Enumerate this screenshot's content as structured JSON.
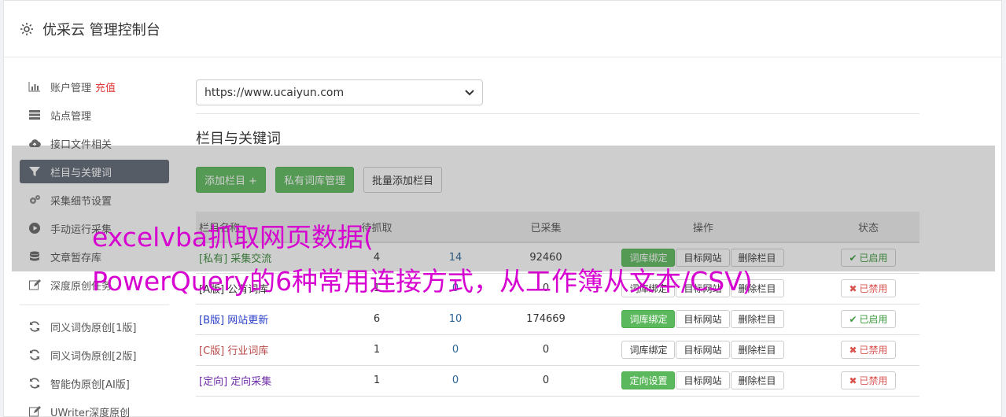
{
  "header": {
    "title": "优采云 管理控制台"
  },
  "sidebar": {
    "group1": [
      {
        "label": "账户管理",
        "extra": "充值",
        "icon": "bar-chart-icon"
      },
      {
        "label": "站点管理",
        "icon": "server-icon"
      },
      {
        "label": "接口文件相关",
        "icon": "cloud-upload-icon"
      },
      {
        "label": "栏目与关键词",
        "icon": "filter-icon",
        "active": true
      },
      {
        "label": "采集细节设置",
        "icon": "cogs-icon"
      },
      {
        "label": "手动运行采集",
        "icon": "play-circle-icon"
      },
      {
        "label": "文章暂存库",
        "icon": "database-icon"
      },
      {
        "label": "深度原创任务",
        "icon": "edit-icon"
      }
    ],
    "group2": [
      {
        "label": "同义词伪原创[1版]",
        "icon": "refresh-icon"
      },
      {
        "label": "同义词伪原创[2版]",
        "icon": "refresh-icon"
      },
      {
        "label": "智能伪原创[AI版]",
        "icon": "refresh-icon"
      },
      {
        "label": "UWriter深度原创",
        "icon": "edit-icon"
      }
    ]
  },
  "main": {
    "site_select": "https://www.ucaiyun.com",
    "section_title": "栏目与关键词",
    "buttons": {
      "add": "添加栏目 +",
      "private": "私有词库管理",
      "batch": "批量添加栏目"
    },
    "table": {
      "headers": [
        "栏目名称",
        "待抓取",
        "已采集",
        "操作",
        "状态"
      ],
      "rows": [
        {
          "tag": "[私有]",
          "name": "采集交流",
          "pending": "4",
          "pending2": "14",
          "collected": "92460",
          "op1": "词库绑定",
          "op1_green": true,
          "status": "已启用",
          "on": true
        },
        {
          "tag": "[A版]",
          "name": "公有词库",
          "pending": "1",
          "pending2": "0",
          "collected": "0",
          "op1": "词库绑定",
          "op1_green": false,
          "status": "已禁用",
          "on": false
        },
        {
          "tag": "[B版]",
          "name": "网站更新",
          "pending": "6",
          "pending2": "10",
          "collected": "174669",
          "op1": "词库绑定",
          "op1_green": true,
          "status": "已启用",
          "on": true
        },
        {
          "tag": "[C版]",
          "name": "行业词库",
          "pending": "1",
          "pending2": "0",
          "collected": "0",
          "op1": "词库绑定",
          "op1_green": false,
          "status": "已禁用",
          "on": false
        },
        {
          "tag": "[定向]",
          "name": "定向采集",
          "pending": "1",
          "pending2": "0",
          "collected": "0",
          "op1": "定向设置",
          "op1_green": true,
          "status": "已禁用",
          "on": false
        }
      ],
      "op2": "目标网站",
      "op3": "删除栏目"
    }
  },
  "overlay": {
    "line1": "excelvba抓取网页数据(",
    "line2": "PowerQuery的6种常用连接方式，从工作簿从文本/CSV)"
  },
  "colors": {
    "green": "#5cb85c",
    "active_bg": "#5f6775",
    "overlay_text": "#d600d0"
  }
}
